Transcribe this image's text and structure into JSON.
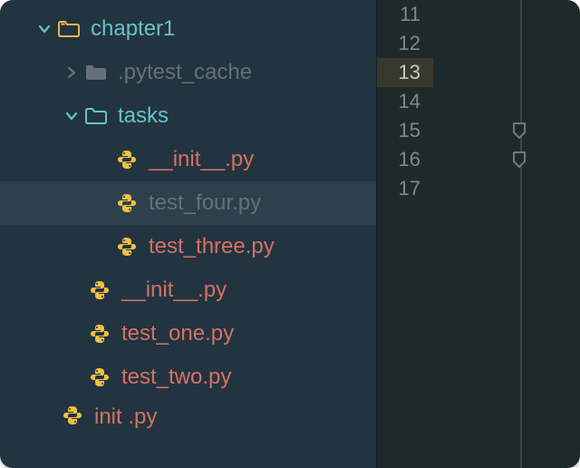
{
  "tree": {
    "root": "chapter1",
    "pytest_cache": ".pytest_cache",
    "tasks": "tasks",
    "tasks_children": {
      "init": "__init__.py",
      "test_four": "test_four.py",
      "test_three": "test_three.py"
    },
    "chapter_init": "__init__.py",
    "test_one": "test_one.py",
    "test_two": "test_two.py",
    "partial_init": "init    .py"
  },
  "selected_file": "test_four.py",
  "gutter": {
    "l1": "11",
    "l2": "12",
    "l3": "13",
    "l4": "14",
    "l5": "15",
    "l6": "16",
    "l7": "17"
  },
  "current_line": "13",
  "colors": {
    "sidebar_bg": "#223440",
    "editor_bg": "#1e2a2a",
    "teal": "#66c2c8",
    "muted": "#64707a",
    "orange": "#d77062",
    "selection": "#2d414d"
  },
  "icons": {
    "chevron_down": "chevron-down-icon",
    "chevron_right": "chevron-right-icon",
    "folder_open": "folder-open-icon",
    "folder_closed": "folder-closed-icon",
    "folder_outline": "folder-outline-icon",
    "python": "python-icon",
    "fold_marker": "fold-marker-icon"
  }
}
